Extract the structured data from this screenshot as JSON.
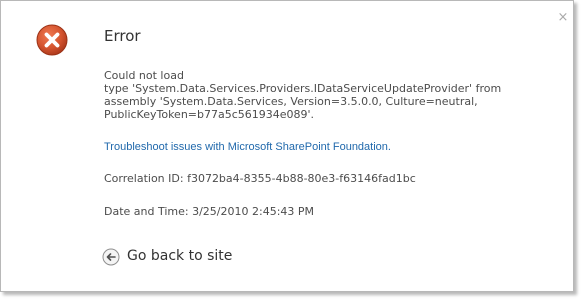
{
  "dialog": {
    "close_glyph": "×",
    "icon": "error-icon",
    "title": "Error",
    "message_lines": [
      "Could not load",
      "type 'System.Data.Services.Providers.IDataServiceUpdateProvider' from",
      "assembly 'System.Data.Services, Version=3.5.0.0, Culture=neutral,",
      "PublicKeyToken=b77a5c561934e089'."
    ],
    "troubleshoot_link": "Troubleshoot issues with Microsoft SharePoint Foundation.",
    "correlation": "Correlation ID: f3072ba4-8355-4b88-80e3-f63146fad1bc",
    "date_time": "Date and Time: 3/25/2010 2:45:43 PM",
    "go_back": {
      "icon": "back-arrow-icon",
      "label": "Go back to site"
    }
  },
  "colors": {
    "error_red": "#d4542f",
    "link_blue": "#2169ac",
    "text": "#4c4c4c",
    "border": "#b8b8b8"
  }
}
